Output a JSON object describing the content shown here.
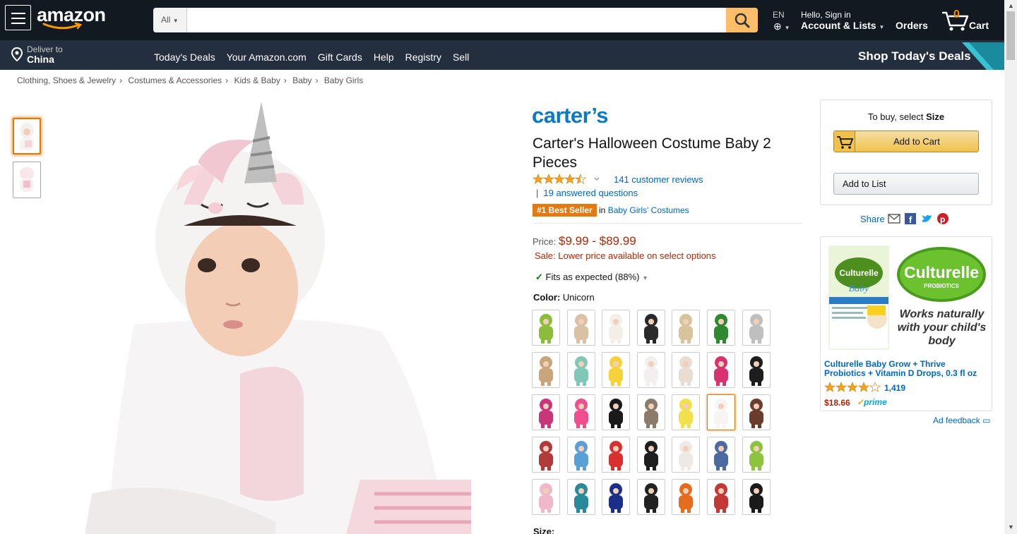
{
  "header": {
    "logo": "amazon",
    "search_dept": "All",
    "search_placeholder": "",
    "lang": "EN",
    "account_small": "Hello, Sign in",
    "account_big": "Account & Lists",
    "orders": "Orders",
    "cart_count": "0",
    "cart_label": "Cart",
    "deliver_small": "Deliver to",
    "deliver_big": "China",
    "nav_links": [
      "Today's Deals",
      "Your Amazon.com",
      "Gift Cards",
      "Help",
      "Registry",
      "Sell"
    ],
    "deals_banner": "Shop Today's Deals"
  },
  "breadcrumb": [
    "Clothing, Shoes & Jewelry",
    "Costumes & Accessories",
    "Kids & Baby",
    "Baby",
    "Baby Girls"
  ],
  "product": {
    "brand": "carter’s",
    "title": "Carter's Halloween Costume Baby 2 Pieces",
    "rating_stars": 4.5,
    "reviews": "141 customer reviews",
    "answered": "19 answered questions",
    "bestseller_badge": "#1 Best Seller",
    "bestseller_in": "in",
    "bestseller_category": "Baby Girls' Costumes",
    "price_label": "Price:",
    "price_value": "$9.99 - $89.99",
    "sale": "Sale:  Lower price available on select options",
    "fits": "Fits as expected (88%)",
    "color_label": "Color:",
    "color_value": "Unicorn",
    "size_label": "Size:",
    "swatch_count": 35,
    "selected_swatch": 19
  },
  "buybox": {
    "title_prefix": "To buy, select",
    "title_bold": "Size",
    "add_to_cart": "Add to Cart",
    "add_to_list": "Add to List",
    "share": "Share"
  },
  "ad": {
    "brand": "Culturelle",
    "sub": "PROBIOTICS",
    "tagline": "Works naturally with your child's body",
    "product": "Culturelle Baby Grow + Thrive Probiotics + Vitamin D Drops, 0.3 fl oz",
    "rating_stars": 4,
    "rating_count": "1,419",
    "price": "$18.66",
    "prime": "prime",
    "feedback": "Ad feedback"
  },
  "colors": {
    "nav_dark": "#131921",
    "nav_light": "#232f3e",
    "accent_orange": "#febd69",
    "link": "#0066c0",
    "price": "#b12704",
    "brand_blue": "#0a7ac2"
  }
}
